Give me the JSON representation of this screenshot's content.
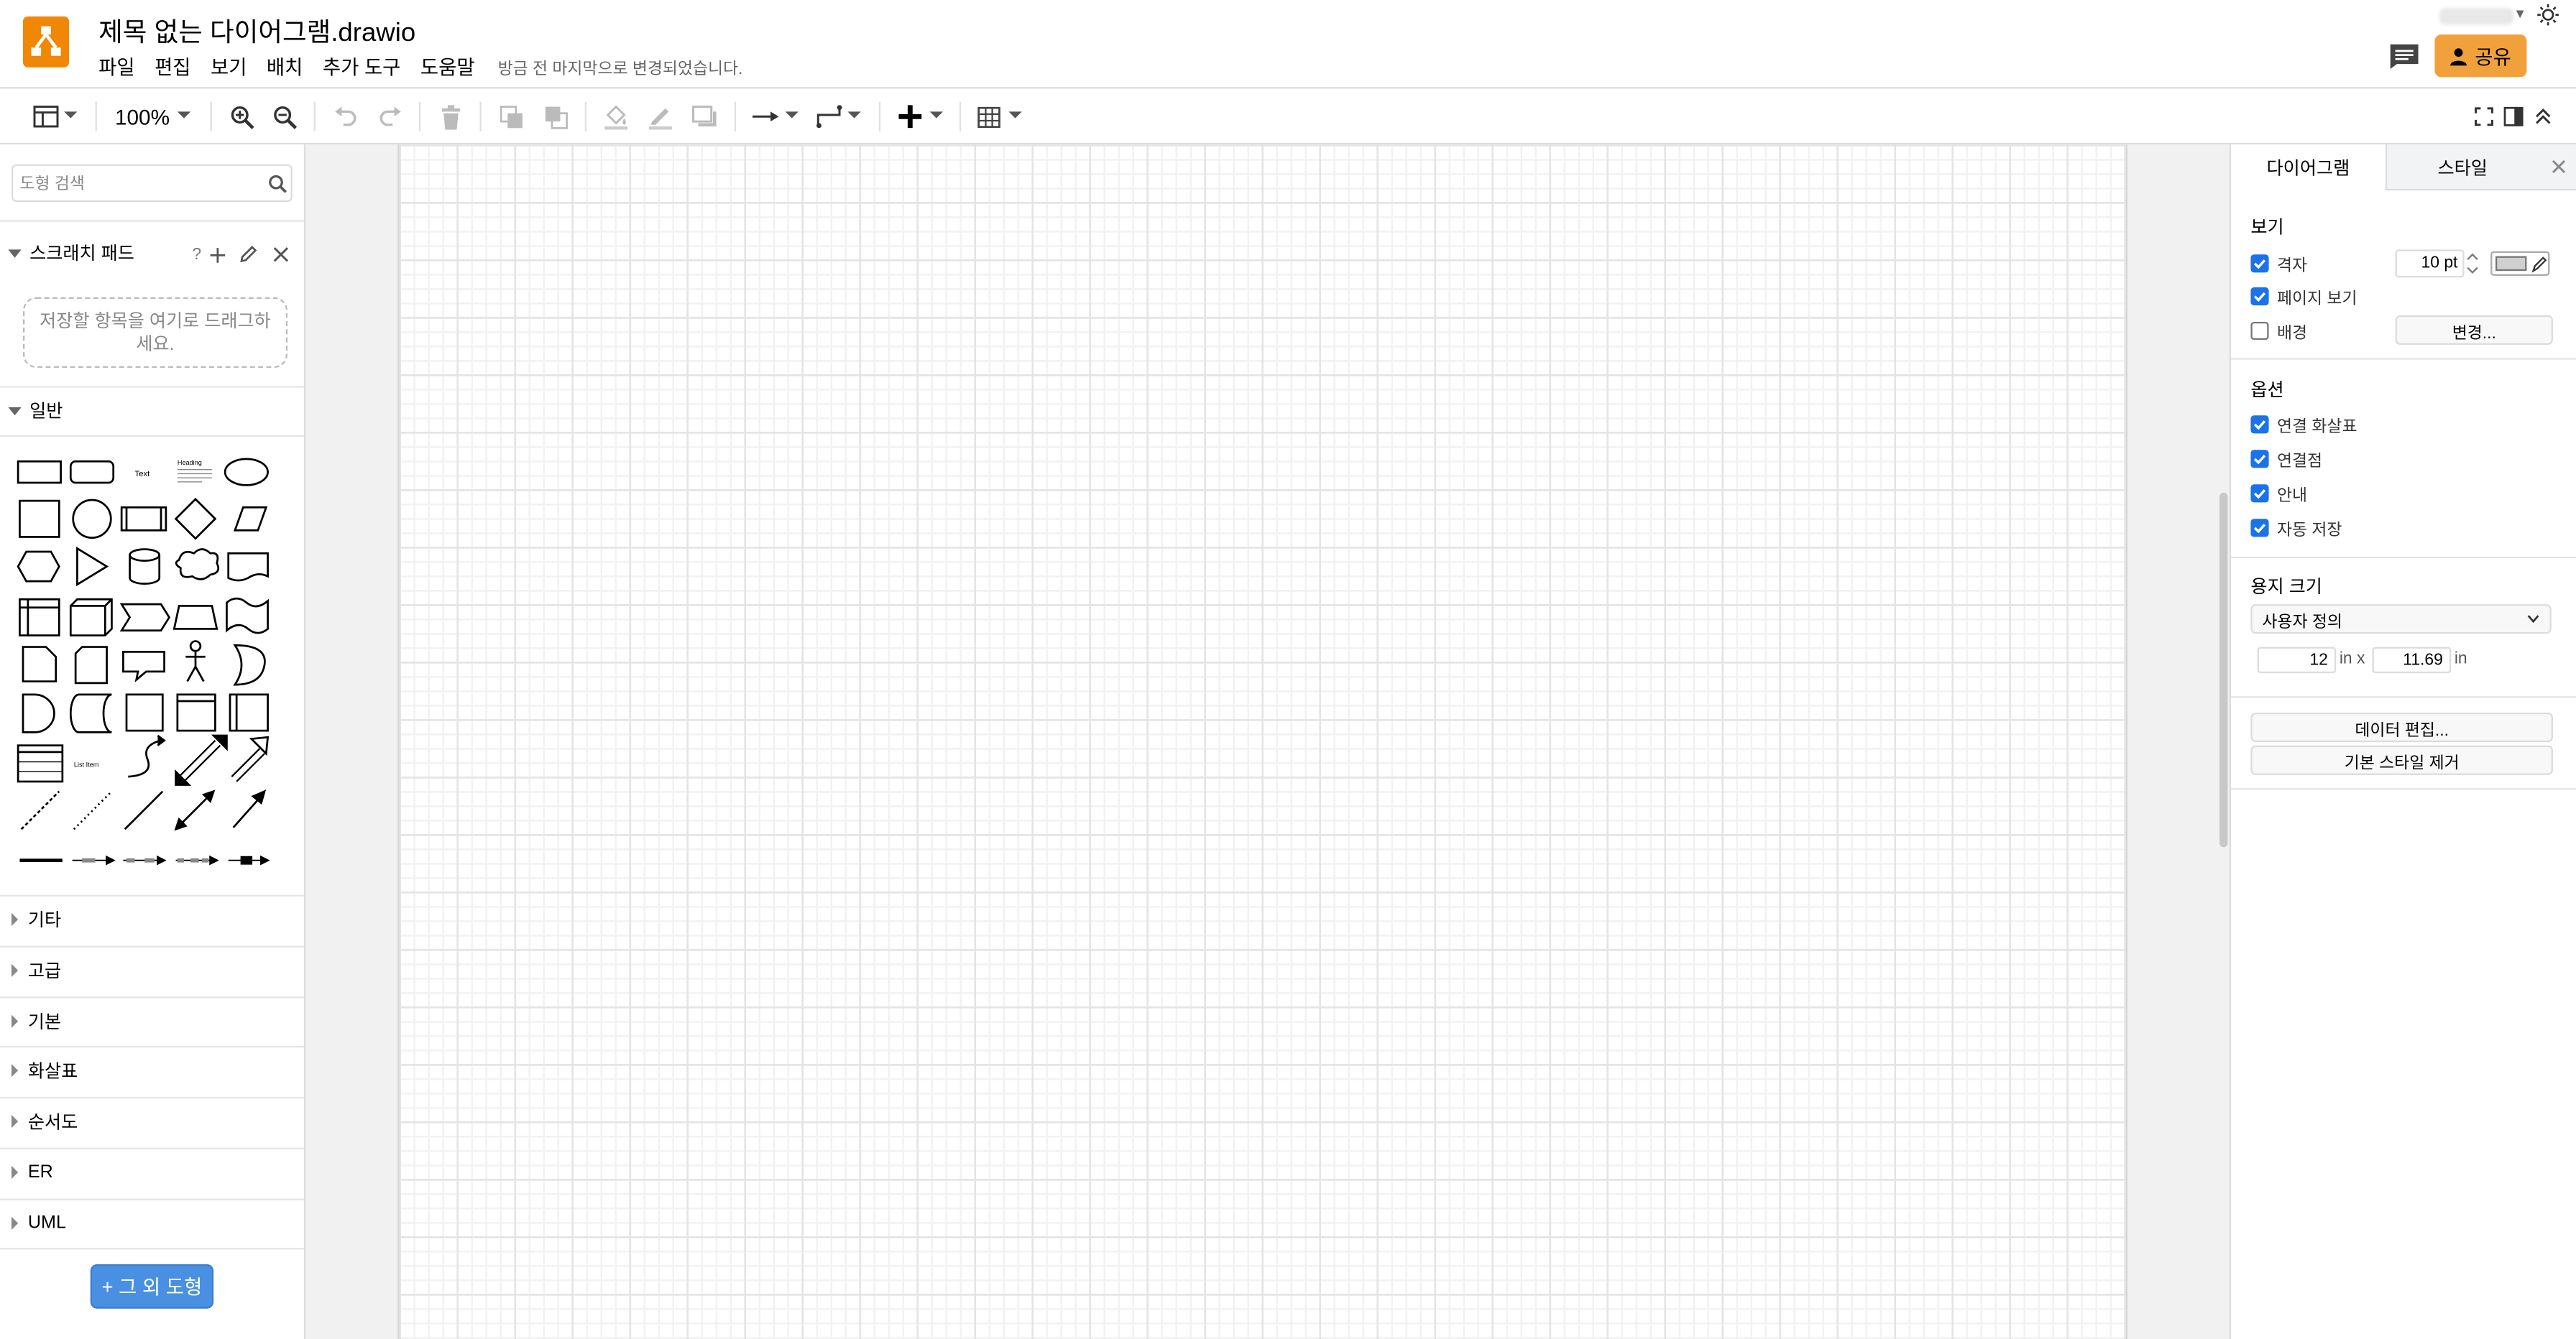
{
  "app": {
    "title": "제목 없는 다이어그램.drawio",
    "save_status": "방금 전 마지막으로 변경되었습니다.",
    "share_label": "공유"
  },
  "menu": [
    "파일",
    "편집",
    "보기",
    "배치",
    "추가 도구",
    "도움말"
  ],
  "toolbar": {
    "zoom": "100%"
  },
  "sidebar": {
    "search_placeholder": "도형 검색",
    "scratchpad": {
      "title": "스크래치 패드",
      "help": "?",
      "drop_hint": "저장할 항목을 여기로 드래그하세요."
    },
    "general_title": "일반",
    "shape_text_label": "Text",
    "shape_heading_label": "Heading",
    "shape_list_label": "List Item",
    "collapsed_sections": [
      "기타",
      "고급",
      "기본",
      "화살표",
      "순서도",
      "ER",
      "UML"
    ],
    "more_shapes": "+ 그 외 도형"
  },
  "panel": {
    "tabs": [
      "다이어그램",
      "스타일"
    ],
    "view_title": "보기",
    "grid_label": "격자",
    "grid_checked": true,
    "grid_size": "10 pt",
    "page_view_label": "페이지 보기",
    "page_view_checked": true,
    "background_label": "배경",
    "background_checked": false,
    "change_button": "변경...",
    "options_title": "옵션",
    "options": [
      {
        "label": "연결 화살표",
        "checked": true
      },
      {
        "label": "연결점",
        "checked": true
      },
      {
        "label": "안내",
        "checked": true
      },
      {
        "label": "자동 저장",
        "checked": true
      }
    ],
    "paper_size_title": "용지 크기",
    "paper_size_value": "사용자 정의",
    "width_value": "12",
    "height_value": "11.69",
    "unit_in": "in",
    "unit_in_x": "in x",
    "edit_data_button": "데이터 편집...",
    "clear_style_button": "기본 스타일 제거"
  },
  "colors": {
    "accent_orange": "#f08705",
    "share_bg": "#f1a13c",
    "checkbox_blue": "#1a73e8",
    "more_shapes_bg": "#4a90e2"
  }
}
